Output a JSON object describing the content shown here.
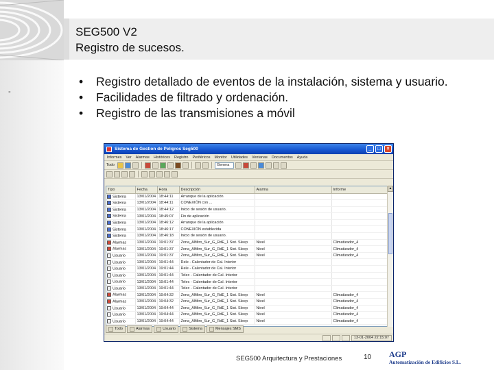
{
  "slide": {
    "title_line1": "SEG500 V2",
    "title_line2": "Registro de sucesos.",
    "side_mark": "-",
    "bullets": [
      "Registro detallado de eventos de la instalación, sistema y usuario.",
      "Facilidades de filtrado y ordenación.",
      "Registro de las transmisiones a móvil"
    ],
    "bullet_glyph": "•"
  },
  "app": {
    "title": "Sistema de Gestion de Peligros Seg500",
    "menu": [
      "Informes",
      "Ver",
      "Alarmas",
      "Históricos",
      "Registro",
      "Periféricos",
      "Monitor",
      "Utilidades",
      "Ventanas",
      "Documentos",
      "Ayuda"
    ],
    "toolbar": {
      "combo_label": "Genera"
    },
    "columns": [
      "Tipo",
      "Fecha",
      "Hora",
      "Descripción",
      "Alarma",
      "Informe"
    ],
    "rows": [
      {
        "icon": "system",
        "type": "Sistema",
        "date": "13/01/2004",
        "time": "18:44:11",
        "desc": "Arranque de la aplicación",
        "alarm": "",
        "report": ""
      },
      {
        "icon": "system",
        "type": "Sistema",
        "date": "13/01/2004",
        "time": "18:44:11",
        "desc": "CONEXIÓN con ...",
        "alarm": "",
        "report": ""
      },
      {
        "icon": "system",
        "type": "Sistema",
        "date": "13/01/2004",
        "time": "18:44:12",
        "desc": "Inicio de sesión de usuario.",
        "alarm": "",
        "report": ""
      },
      {
        "icon": "system",
        "type": "Sistema",
        "date": "13/01/2004",
        "time": "18:45:07",
        "desc": "Fin de aplicación",
        "alarm": "",
        "report": ""
      },
      {
        "icon": "system",
        "type": "Sistema",
        "date": "13/01/2004",
        "time": "18:46:12",
        "desc": "Arranque de la aplicación",
        "alarm": "",
        "report": ""
      },
      {
        "icon": "system",
        "type": "Sistema",
        "date": "13/01/2004",
        "time": "18:46:17",
        "desc": "CONEXIÓN establecida",
        "alarm": "",
        "report": ""
      },
      {
        "icon": "system",
        "type": "Sistema",
        "date": "13/01/2004",
        "time": "18:46:18",
        "desc": "Inicio de sesión de usuario.",
        "alarm": "",
        "report": ""
      },
      {
        "icon": "alarm",
        "type": "Alarmas",
        "date": "13/01/2004",
        "time": "19:01:37",
        "desc": "Zona_Alfiltro_Sur_G_RdE_1 Sist. Sleep",
        "alarm": "Nivel",
        "report": "Climatizador_4"
      },
      {
        "icon": "alarm",
        "type": "Alarmas",
        "date": "13/01/2004",
        "time": "19:01:37",
        "desc": "Zona_Alfiltro_Sur_G_RdE_1 Sist. Sleep",
        "alarm": "Nivel",
        "report": "Climatizador_4"
      },
      {
        "icon": "user",
        "type": "Usuario",
        "date": "13/01/2004",
        "time": "19:01:37",
        "desc": "Zona_Alfiltro_Sur_G_RdE_1 Sist. Sleep",
        "alarm": "Nivel",
        "report": "Climatizador_4"
      },
      {
        "icon": "user",
        "type": "Usuario",
        "date": "13/01/2004",
        "time": "19:01:44",
        "desc": "Rele - Calentador de Cal. Interior",
        "alarm": "",
        "report": ""
      },
      {
        "icon": "user",
        "type": "Usuario",
        "date": "13/01/2004",
        "time": "19:01:44",
        "desc": "Rele - Calentador de Cal. Interior",
        "alarm": "",
        "report": ""
      },
      {
        "icon": "user",
        "type": "Usuario",
        "date": "13/01/2004",
        "time": "19:01:44",
        "desc": "Telec - Calentador de Cal. Interior",
        "alarm": "",
        "report": ""
      },
      {
        "icon": "user",
        "type": "Usuario",
        "date": "13/01/2004",
        "time": "19:01:44",
        "desc": "Telec - Calentador de Cal. Interior",
        "alarm": "",
        "report": ""
      },
      {
        "icon": "user",
        "type": "Usuario",
        "date": "13/01/2004",
        "time": "19:01:44",
        "desc": "Telec - Calentador de Cal. Interior",
        "alarm": "",
        "report": ""
      },
      {
        "icon": "alarm",
        "type": "Alarmas",
        "date": "13/01/2004",
        "time": "19:04:32",
        "desc": "Zona_Alfiltro_Sur_G_RdE_1 Sist. Sleep",
        "alarm": "Nivel",
        "report": "Climatizador_4"
      },
      {
        "icon": "alarm",
        "type": "Alarmas",
        "date": "13/01/2004",
        "time": "19:04:32",
        "desc": "Zona_Alfiltro_Sur_G_RdE_1 Sist. Sleep",
        "alarm": "Nivel",
        "report": "Climatizador_4"
      },
      {
        "icon": "user",
        "type": "Usuario",
        "date": "13/01/2004",
        "time": "19:04:44",
        "desc": "Zona_Alfiltro_Sur_G_RdE_1 Sist. Sleep",
        "alarm": "Nivel",
        "report": "Climatizador_4"
      },
      {
        "icon": "user",
        "type": "Usuario",
        "date": "13/01/2004",
        "time": "19:04:44",
        "desc": "Zona_Alfiltro_Sur_G_RdE_1 Sist. Sleep",
        "alarm": "Nivel",
        "report": "Climatizador_4"
      },
      {
        "icon": "user",
        "type": "Usuario",
        "date": "13/01/2004",
        "time": "19:04:44",
        "desc": "Zona_Alfiltro_Sur_G_RdE_1 Sist. Sleep",
        "alarm": "Nivel",
        "report": "Climatizador_4"
      }
    ],
    "taskbar": [
      "Todo",
      "Alarmas",
      "Usuario",
      "Sistema",
      "Mensajes SMS"
    ],
    "status_time": "13-01-2004 22:15:07"
  },
  "footer": {
    "text": "SEG500 Arquitectura y Prestaciones",
    "page": "10",
    "logo_mark": "AGP",
    "logo_company": "Automatización de Edificios S.L."
  },
  "colors": {
    "titlebar": "#1656d0",
    "logo": "#1b3a8a",
    "alarm_icon": "#d04a3a",
    "system_icon": "#4a6fd0"
  }
}
